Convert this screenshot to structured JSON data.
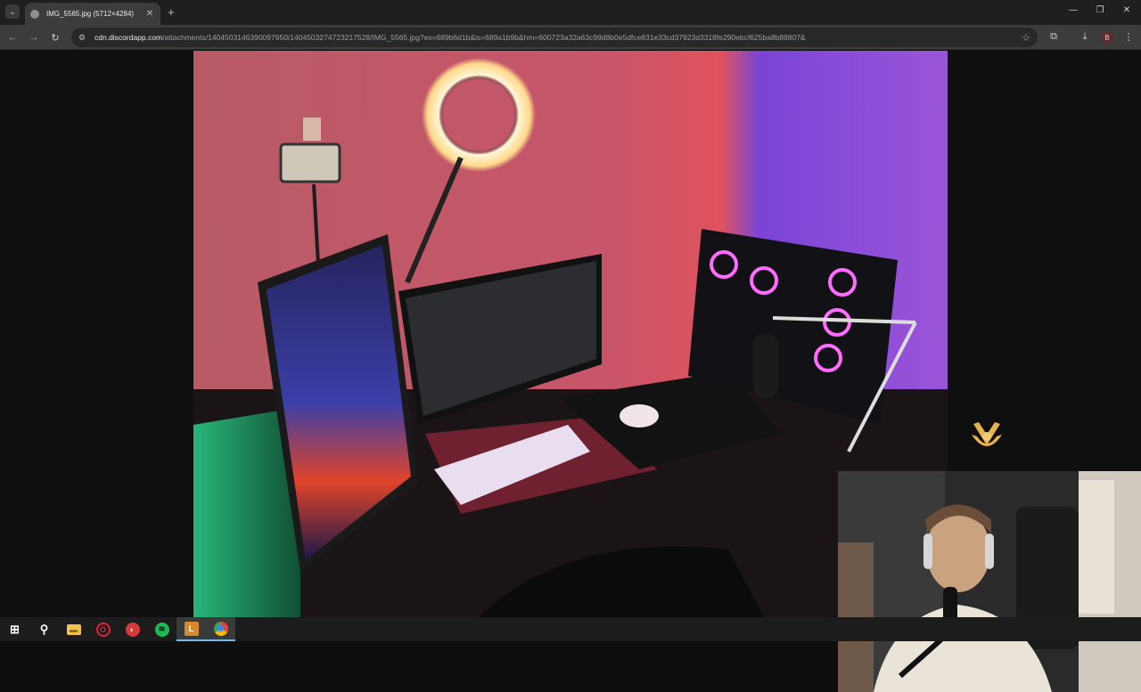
{
  "browser": {
    "tab_title": "IMG_5565.jpg (5712×4284)",
    "tab_close": "✕",
    "new_tab": "+",
    "url_host": "cdn.discordapp.com",
    "url_path": "/attachments/1404503146390097950/1404503274723217528/IMG_5565.jpg?ex=689b6d1b&is=689a1b9b&hm=600723a32a63c99d8b0e5dfce831e33cd37923d3318fe290ebcf625ba8b89807&",
    "profile_initial": "B",
    "icons": [
      "tab-list-icon",
      "back-icon",
      "forward-icon",
      "reload-icon",
      "site-info-icon",
      "bookmark-star-icon",
      "extensions-icon",
      "download-icon",
      "menu-icon",
      "minimize-icon",
      "restore-icon",
      "close-icon"
    ]
  },
  "content": {
    "image_alt": "Desk setup photo",
    "overlay_logo": "channel-logo",
    "webcam": "streamer-webcam"
  },
  "taskbar": {
    "items": [
      {
        "name": "windows-start-icon",
        "glyph": "⊞",
        "color": "#ffffff"
      },
      {
        "name": "search-icon",
        "glyph": "⚲",
        "color": "#ffffff"
      },
      {
        "name": "file-explorer-icon",
        "glyph": "▬",
        "color": "#f2c14e"
      },
      {
        "name": "opera-icon",
        "glyph": "O",
        "color": "#e0243b"
      },
      {
        "name": "app-icon",
        "glyph": "◐",
        "color": "#d53a3a"
      },
      {
        "name": "spotify-icon",
        "glyph": "≋",
        "color": "#1db954"
      },
      {
        "name": "app-orange-icon",
        "glyph": "L",
        "color": "#d58a2c"
      },
      {
        "name": "chrome-icon",
        "glyph": "◉",
        "color": "#4285f4"
      }
    ]
  }
}
